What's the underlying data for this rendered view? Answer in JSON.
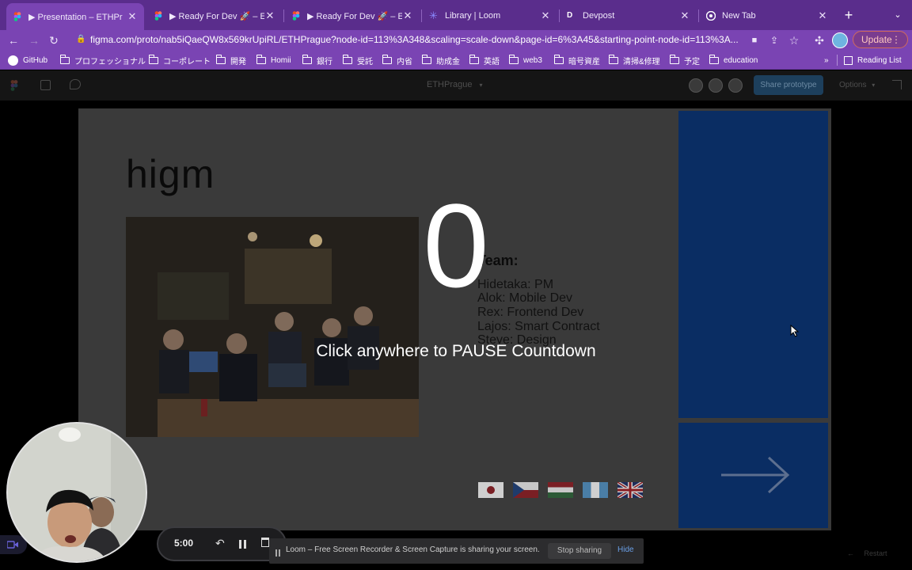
{
  "browser": {
    "tabs": [
      {
        "title": "▶ Presentation – ETHPr",
        "icon": "figma-icon",
        "active": true
      },
      {
        "title": "▶ Ready For Dev 🚀 – ETH",
        "icon": "figma-icon",
        "active": false
      },
      {
        "title": "▶ Ready For Dev 🚀 – ETH",
        "icon": "figma-icon",
        "active": false
      },
      {
        "title": "Library | Loom",
        "icon": "loom-icon",
        "active": false
      },
      {
        "title": "Devpost",
        "icon": "devpost-icon",
        "active": false
      },
      {
        "title": "New Tab",
        "icon": "chrome-icon",
        "active": false
      }
    ],
    "url": "figma.com/proto/nab5iQaeQW8x569krUpiRL/ETHPrague?node-id=113%3A348&scaling=scale-down&page-id=6%3A45&starting-point-node-id=113%3A...",
    "update_label": "Update",
    "bookmarks": [
      "GitHub",
      "プロフェッショナル",
      "コーポレート",
      "開発",
      "Homii",
      "銀行",
      "受託",
      "内省",
      "助成金",
      "英語",
      "web3",
      "暗号資産",
      "清掃&修理",
      "予定",
      "education"
    ],
    "reading_list": "Reading List",
    "more_bookmarks": "»"
  },
  "figma": {
    "file_name": "ETHPrague",
    "share_label": "Share prototype",
    "options_label": "Options",
    "restart_label": "Restart"
  },
  "slide": {
    "title": "higm",
    "team_heading": "Team:",
    "members": [
      "Hidetaka: PM",
      "Alok: Mobile Dev",
      "Rex: Frontend Dev",
      "Lajos: Smart Contract",
      "Steve: Design"
    ],
    "flags": [
      "japan-flag",
      "czech-flag",
      "hungary-flag",
      "guatemala-flag",
      "uk-flag"
    ],
    "panel_color": "#0a2d63"
  },
  "overlay": {
    "countdown": "0",
    "hint": "Click anywhere to PAUSE Countdown"
  },
  "loom": {
    "timer": "5:00",
    "banner_text": "Loom – Free Screen Recorder & Screen Capture is sharing your screen.",
    "stop_label": "Stop sharing",
    "hide_label": "Hide"
  }
}
